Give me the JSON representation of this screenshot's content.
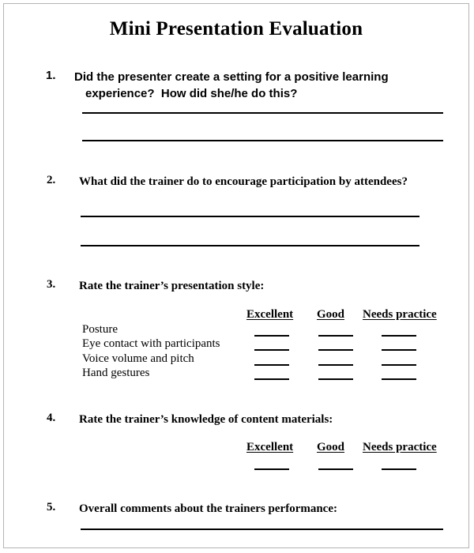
{
  "document": {
    "title": "Mini Presentation Evaluation",
    "page_border_color": "#b4b4b4",
    "ink_color": "#000000",
    "background_color": "#ffffff"
  },
  "questions": [
    {
      "number": "1.",
      "line1": "Did the presenter create a setting for a positive learning",
      "line2": "experience?  How did she/he do this?",
      "answer_lines": 2
    },
    {
      "number": "2.",
      "text": "What did the trainer do to encourage participation by attendees?",
      "answer_lines": 2
    },
    {
      "number": "3.",
      "text": "Rate the trainer’s presentation style:"
    },
    {
      "number": "4.",
      "text": "Rate the trainer’s knowledge of content materials:"
    },
    {
      "number": "5.",
      "text": "Overall comments about the trainers performance:",
      "answer_lines": 1
    }
  ],
  "rating_scale": {
    "columns": [
      "Excellent",
      "Good",
      "Needs practice"
    ]
  },
  "style_table": {
    "rows": [
      "Posture",
      "Eye contact with participants",
      "Voice volume and pitch",
      "Hand gestures"
    ]
  },
  "knowledge_table": {
    "rows": [
      ""
    ]
  }
}
